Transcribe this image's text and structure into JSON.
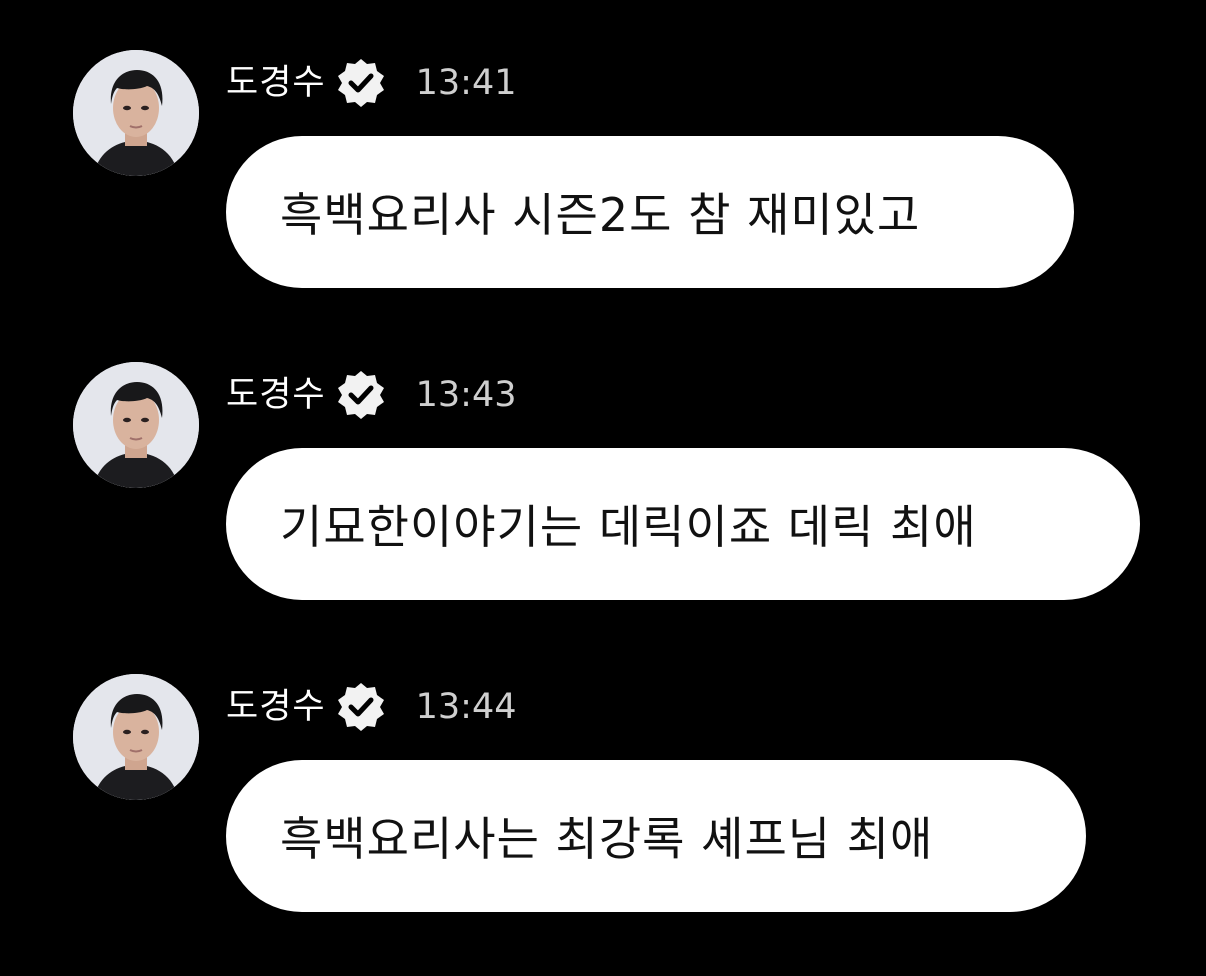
{
  "colors": {
    "background": "#000000",
    "bubble": "#ffffff",
    "text_dark": "#111111",
    "name_text": "#ffffff",
    "time_text": "#cfcfcf"
  },
  "messages": [
    {
      "sender": "도경수",
      "badge_icon": "verified-badge-icon",
      "time": "13:41",
      "text": "흑백요리사 시즌2도 참 재미있고"
    },
    {
      "sender": "도경수",
      "badge_icon": "verified-badge-icon",
      "time": "13:43",
      "text": "기묘한이야기는 데릭이죠 데릭 최애"
    },
    {
      "sender": "도경수",
      "badge_icon": "verified-badge-icon",
      "time": "13:44",
      "text": "흑백요리사는 최강록 셰프님 최애"
    }
  ]
}
